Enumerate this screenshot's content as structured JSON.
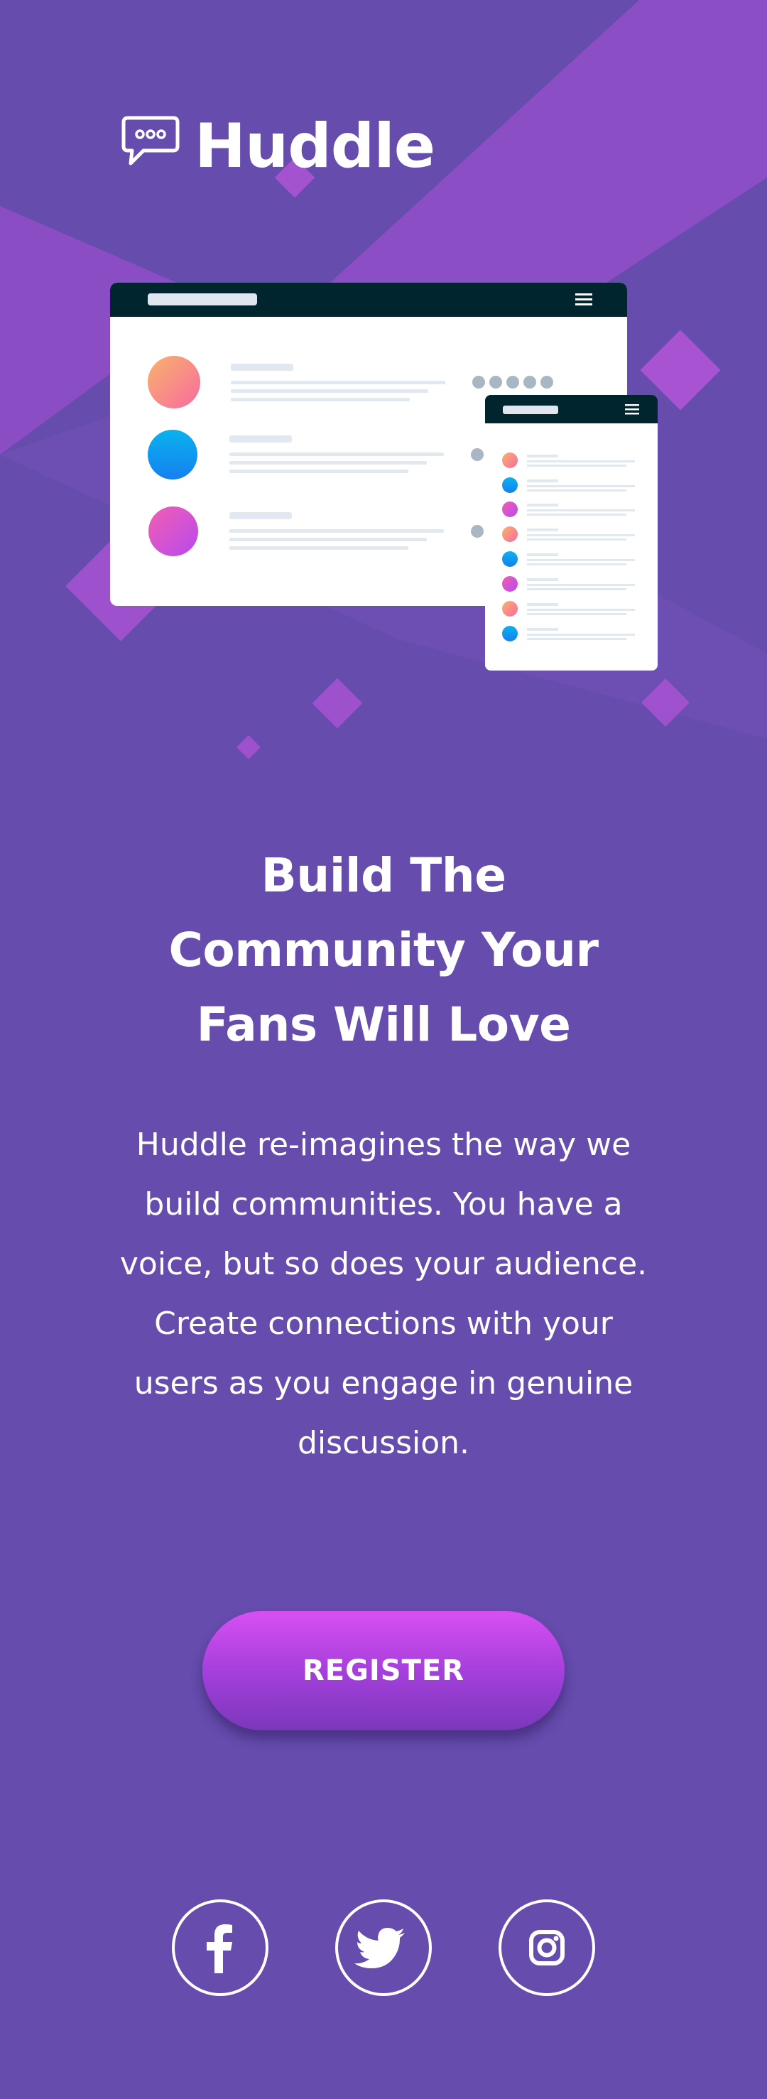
{
  "brand": {
    "name": "Huddle"
  },
  "hero": {
    "title_lines": [
      "Build The",
      "Community Your",
      "Fans Will Love"
    ],
    "description_lines": [
      "Huddle re-imagines the way we",
      "build communities. You have a",
      "voice, but so does your audience.",
      "Create connections with your",
      "users as you engage in genuine",
      "discussion."
    ]
  },
  "cta": {
    "register_label": "REGISTER"
  },
  "social": [
    {
      "icon": "facebook-icon"
    },
    {
      "icon": "twitter-icon"
    },
    {
      "icon": "instagram-icon"
    }
  ],
  "colors": {
    "background": "#654cad",
    "accent_pink": "#c14ee8",
    "dark_bar": "#00252e",
    "white": "#ffffff"
  }
}
